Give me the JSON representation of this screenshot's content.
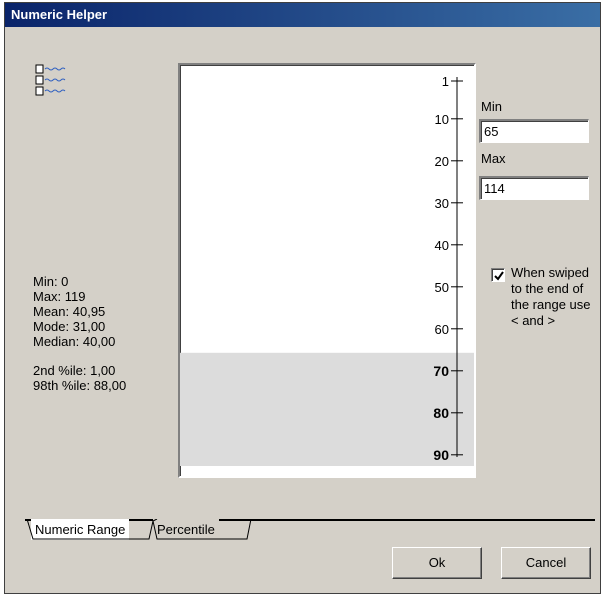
{
  "window": {
    "title": "Numeric Helper"
  },
  "stats": {
    "min": "Min: 0",
    "max": "Max: 119",
    "mean": "Mean: 40,95",
    "mode": "Mode: 31,00",
    "median": "Median: 40,00",
    "p2": "2nd %ile: 1,00",
    "p98": "98th %ile: 88,00"
  },
  "scale": {
    "ticks": [
      {
        "label": "1",
        "value": 1,
        "bold": false
      },
      {
        "label": "10",
        "value": 10,
        "bold": false
      },
      {
        "label": "20",
        "value": 20,
        "bold": false
      },
      {
        "label": "30",
        "value": 30,
        "bold": false
      },
      {
        "label": "40",
        "value": 40,
        "bold": false
      },
      {
        "label": "50",
        "value": 50,
        "bold": false
      },
      {
        "label": "60",
        "value": 60,
        "bold": false
      },
      {
        "label": "70",
        "value": 70,
        "bold": true
      },
      {
        "label": "80",
        "value": 80,
        "bold": true
      },
      {
        "label": "90",
        "value": 90,
        "bold": true
      }
    ],
    "highlight_from": 65,
    "highlight_to": 91,
    "highlight_color": "#dcdcdc"
  },
  "range": {
    "min_label": "Min",
    "min_value": "65",
    "max_label": "Max",
    "max_value": "114"
  },
  "options": {
    "swipe_checked": true,
    "swipe_text": "When swiped to the end of the range use < and >"
  },
  "tabs": [
    {
      "label": "Numeric Range",
      "active": true
    },
    {
      "label": "Percentile",
      "active": false
    }
  ],
  "buttons": {
    "ok": "Ok",
    "cancel": "Cancel"
  },
  "colors": {
    "titlebar_start": "#0a246a",
    "titlebar_end": "#3a6ea5",
    "dialog_bg": "#d4d0c8"
  }
}
